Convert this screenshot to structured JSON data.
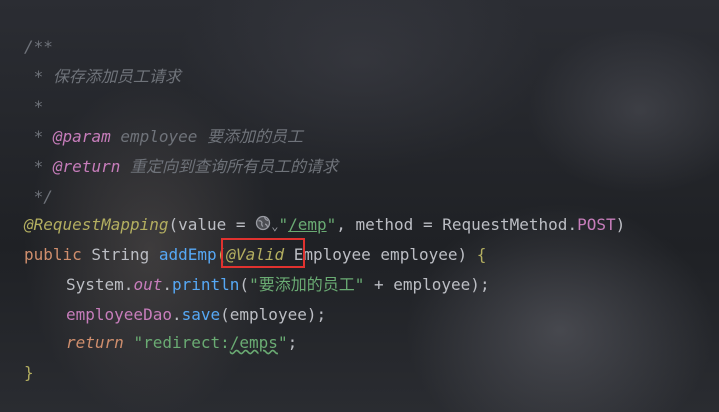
{
  "code": {
    "l1": "/**",
    "l2_star": " * ",
    "l2_text": "保存添加员工请求",
    "l3": " *",
    "l4_star": " * ",
    "l4_tag": "@param",
    "l4_name": " employee",
    "l4_desc": " 要添加的员工",
    "l5_star": " * ",
    "l5_tag": "@return",
    "l5_desc": " 重定向到查询所有员工的请求",
    "l6": " */",
    "l7_ann": "@RequestMapping",
    "l7_open": "(value = ",
    "l7_dropdown": "⌄",
    "l7_quote1": "\"",
    "l7_path": "/emp",
    "l7_quote2": "\"",
    "l7_mid": ", method = RequestMethod.",
    "l7_post": "POST",
    "l7_close": ")",
    "l8_public": "public",
    "l8_string": " String ",
    "l8_fn": "addEmp",
    "l8_paren": "(",
    "l8_valid": "@Valid",
    "l8_rest": " Employee employee) ",
    "l8_brace": "{",
    "l9_sys": "System.",
    "l9_out": "out",
    "l9_dot": ".",
    "l9_fn": "println",
    "l9_open": "(",
    "l9_str": "\"要添加的员工\"",
    "l9_rest": " + employee);",
    "l10_field": "employeeDao",
    "l10_dot": ".",
    "l10_fn": "save",
    "l10_rest": "(employee);",
    "l11_kw": "return",
    "l11_sp": " ",
    "l11_q1": "\"redirect:",
    "l11_path": "/emps",
    "l11_q2": "\"",
    "l11_end": ";",
    "l12": "}"
  },
  "icons": {
    "globe": "globe-icon",
    "dropdown": "chevron-down-icon"
  },
  "colors": {
    "comment": "#6f737a",
    "doc_tag": "#c77dbb",
    "annotation": "#b3ae60",
    "keyword": "#cf8e6d",
    "string": "#6aab73",
    "function": "#56a8f5",
    "highlight": "#e0322f"
  }
}
